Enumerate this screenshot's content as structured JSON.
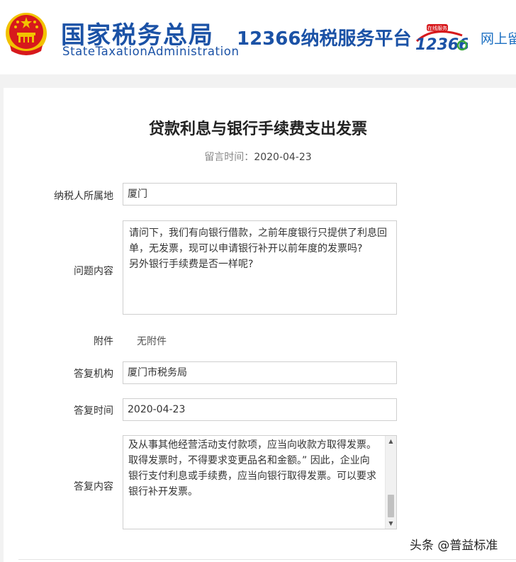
{
  "header": {
    "brand_cn": "国家税务总局",
    "brand_en": "StateTaxationAdministration",
    "platform": "12366纳税服务平台",
    "logo_text": "12366",
    "logo_badge": "在线服务",
    "online": "网上留"
  },
  "page": {
    "title": "贷款利息与银行手续费支出发票",
    "time_label": "留言时间：",
    "time_value": "2020-04-23"
  },
  "form": {
    "location_label": "纳税人所属地",
    "location_value": "厦门",
    "question_label": "问题内容",
    "question_lines": [
      "请问下，我们有向银行借款，之前年度银行只提供了利息回",
      "单，无发票，现可以申请银行补开以前年度的发票吗?",
      "另外银行手续费是否一样呢?"
    ],
    "attachment_label": "附件",
    "attachment_value": "无附件",
    "agency_label": "答复机构",
    "agency_value": "厦门市税务局",
    "reply_time_label": "答复时间",
    "reply_time_value": "2020-04-23",
    "reply_label": "答复内容",
    "reply_lines": [
      "及从事其他经营活动支付款项，应当向收款方取得发票。",
      "取得发票时，不得要求变更品名和金额。” 因此，企业向",
      "银行支付利息或手续费，应当向银行取得发票。可以要求",
      "银行补开发票。"
    ]
  },
  "watermark": "头条 @普益标准",
  "colors": {
    "brand_blue": "#1b52a6",
    "emblem_red": "#d7191c",
    "emblem_gold": "#f2c200"
  }
}
